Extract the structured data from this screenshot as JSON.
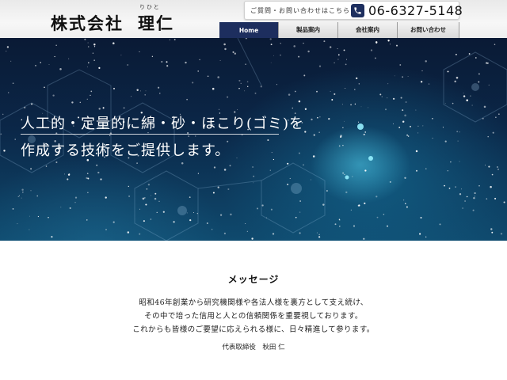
{
  "header": {
    "logo_company": "株式会社",
    "logo_name": "理仁",
    "logo_ruby": "りひと",
    "contact_label": "ご質問・お問い合わせはこちら",
    "phone_number": "06-6327-5148",
    "phone_icon": "phone-icon",
    "nav": [
      {
        "label": "Home",
        "active": true
      },
      {
        "label": "製品案内",
        "active": false
      },
      {
        "label": "会社案内",
        "active": false
      },
      {
        "label": "お問い合わせ",
        "active": false
      }
    ],
    "accent_color": "#1d2e5e"
  },
  "hero": {
    "line1": "人工的・定量的に綿・砂・ほこり(ゴミ)を",
    "line2": "作成する技術をご提供します。"
  },
  "message": {
    "title": "メッセージ",
    "lines": [
      "昭和46年創業から研究機関様や各法人様を裏方として支え続け、",
      "その中で培った信用と人との信頼関係を重要視しております。",
      "これからも皆様のご要望に応えられる様に、日々精進して参ります。"
    ],
    "signature": "代表取締役　秋田 仁"
  }
}
